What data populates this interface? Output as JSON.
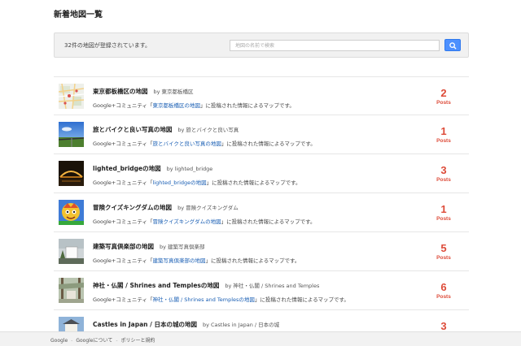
{
  "page": {
    "title": "新着地図一覧",
    "summary": "32件の地図が登録されています。",
    "search_placeholder": "地図の名前で検索"
  },
  "maps": [
    {
      "title": "東京都板橋区の地図",
      "by": "by 東京都板橋区",
      "desc_pre": "Google+コミュニティ「",
      "desc_link": "東京都板橋区の地図",
      "desc_post": "」に投稿された情報によるマップです。",
      "count": "2",
      "count_label": "Posts"
    },
    {
      "title": "旅とバイクと良い写真の地図",
      "by": "by 旅とバイクと良い写真",
      "desc_pre": "Google+コミュニティ「",
      "desc_link": "旅とバイクと良い写真の地図",
      "desc_post": "」に投稿された情報によるマップです。",
      "count": "1",
      "count_label": "Posts"
    },
    {
      "title": "lighted_bridgeの地図",
      "by": "by lighted_bridge",
      "desc_pre": "Google+コミュニティ「",
      "desc_link": "lighted_bridgeの地図",
      "desc_post": "」に投稿された情報によるマップです。",
      "count": "3",
      "count_label": "Posts"
    },
    {
      "title": "冒険クイズキングダムの地図",
      "by": "by 冒険クイズキングダム",
      "desc_pre": "Google+コミュニティ「",
      "desc_link": "冒険クイズキングダムの地図",
      "desc_post": "」に投稿された情報によるマップです。",
      "count": "1",
      "count_label": "Posts"
    },
    {
      "title": "建築写真倶楽部の地図",
      "by": "by 建築写真倶楽部",
      "desc_pre": "Google+コミュニティ「",
      "desc_link": "建築写真倶楽部の地図",
      "desc_post": "」に投稿された情報によるマップです。",
      "count": "5",
      "count_label": "Posts"
    },
    {
      "title": "神社・仏閣 / Shrines and Templesの地図",
      "by": "by 神社・仏閣 / Shrines and Temples",
      "desc_pre": "Google+コミュニティ「",
      "desc_link": "神社・仏閣 / Shrines and Templesの地図",
      "desc_post": "」に投稿された情報によるマップです。",
      "count": "6",
      "count_label": "Posts"
    },
    {
      "title": "Castles in Japan / 日本の城の地図",
      "by": "by Castles in Japan / 日本の城",
      "desc_pre": "",
      "desc_link": "",
      "desc_post": "",
      "count": "3",
      "count_label": ""
    }
  ],
  "footer": {
    "links": [
      "Google",
      "Googleについて",
      "ポリシーと規約"
    ]
  },
  "colors": {
    "accent_red": "#dd4b39",
    "link_blue": "#1a5fb4",
    "button_blue": "#4d90fe"
  }
}
